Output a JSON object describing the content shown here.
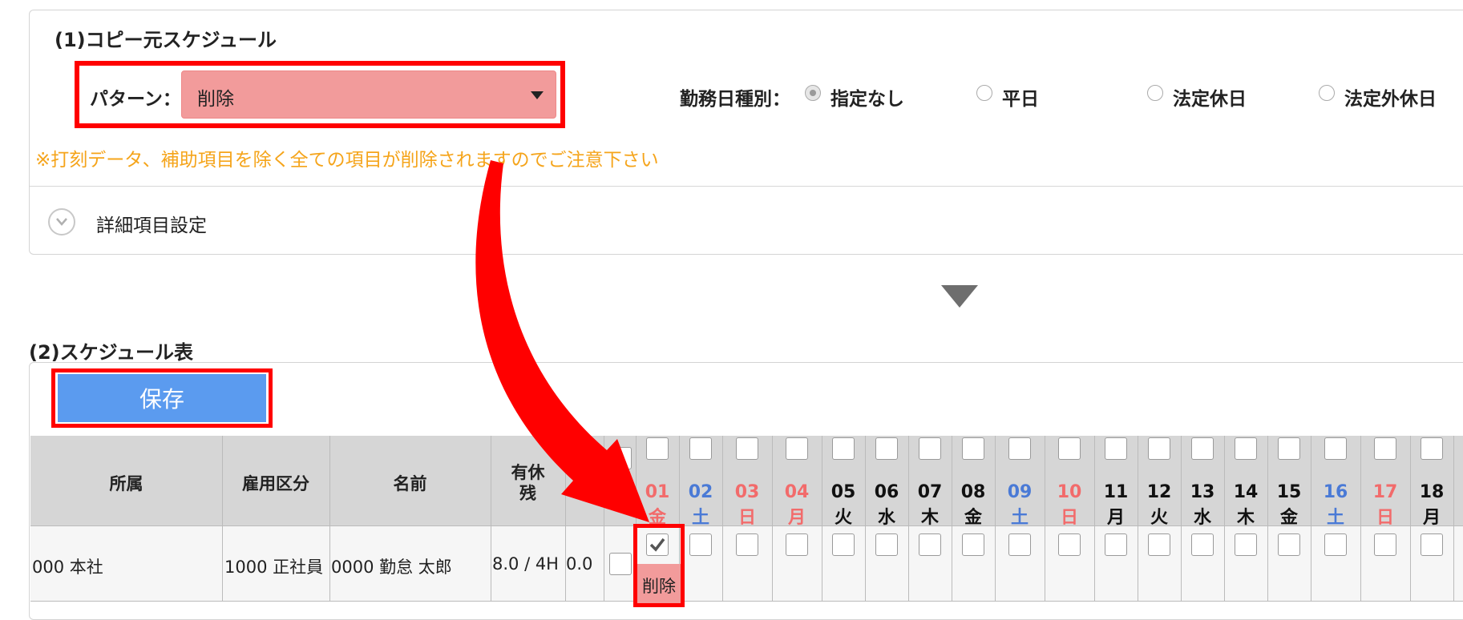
{
  "copy_source": {
    "title": "(1)コピー元スケジュール",
    "pattern_label": "パターン：",
    "pattern_value": "削除",
    "worktype_label": "勤務日種別：",
    "worktype_options": [
      {
        "label": "指定なし",
        "checked": true
      },
      {
        "label": "平日",
        "checked": false
      },
      {
        "label": "法定休日",
        "checked": false
      },
      {
        "label": "法定外休日",
        "checked": false
      }
    ],
    "warning": "※打刻データ、補助項目を除く全ての項目が削除されますのでご注意下さい",
    "detail_label": "詳細項目設定"
  },
  "schedule": {
    "title": "(2)スケジュール表",
    "save_label": "保存",
    "headers": {
      "dept": "所属",
      "employment": "雇用区分",
      "name": "名前",
      "paid_leave_1": "有休",
      "paid_leave_2": "残"
    },
    "days": [
      {
        "num": "01",
        "wd": "金",
        "color": "red"
      },
      {
        "num": "02",
        "wd": "土",
        "color": "blue"
      },
      {
        "num": "03",
        "wd": "日",
        "color": "red"
      },
      {
        "num": "04",
        "wd": "月",
        "color": "red"
      },
      {
        "num": "05",
        "wd": "火",
        "color": "black"
      },
      {
        "num": "06",
        "wd": "水",
        "color": "black"
      },
      {
        "num": "07",
        "wd": "木",
        "color": "black"
      },
      {
        "num": "08",
        "wd": "金",
        "color": "black"
      },
      {
        "num": "09",
        "wd": "土",
        "color": "blue"
      },
      {
        "num": "10",
        "wd": "日",
        "color": "red"
      },
      {
        "num": "11",
        "wd": "月",
        "color": "black"
      },
      {
        "num": "12",
        "wd": "火",
        "color": "black"
      },
      {
        "num": "13",
        "wd": "水",
        "color": "black"
      },
      {
        "num": "14",
        "wd": "木",
        "color": "black"
      },
      {
        "num": "15",
        "wd": "金",
        "color": "black"
      },
      {
        "num": "16",
        "wd": "土",
        "color": "blue"
      },
      {
        "num": "17",
        "wd": "日",
        "color": "red"
      },
      {
        "num": "18",
        "wd": "月",
        "color": "black"
      }
    ],
    "row": {
      "dept": "000 本社",
      "employment": "1000 正社員",
      "name": "0000 勤怠 太郎",
      "paid_leave": "8.0 / 4H",
      "extra": "0.0",
      "day01_label": "削除"
    }
  },
  "colors": {
    "highlight": "#ff0000",
    "warning": "#f5a41a",
    "save_button": "#5b9bef",
    "pattern_select": "#f29b9b",
    "holiday": "#f26b6b",
    "saturday": "#4a7ad6"
  }
}
